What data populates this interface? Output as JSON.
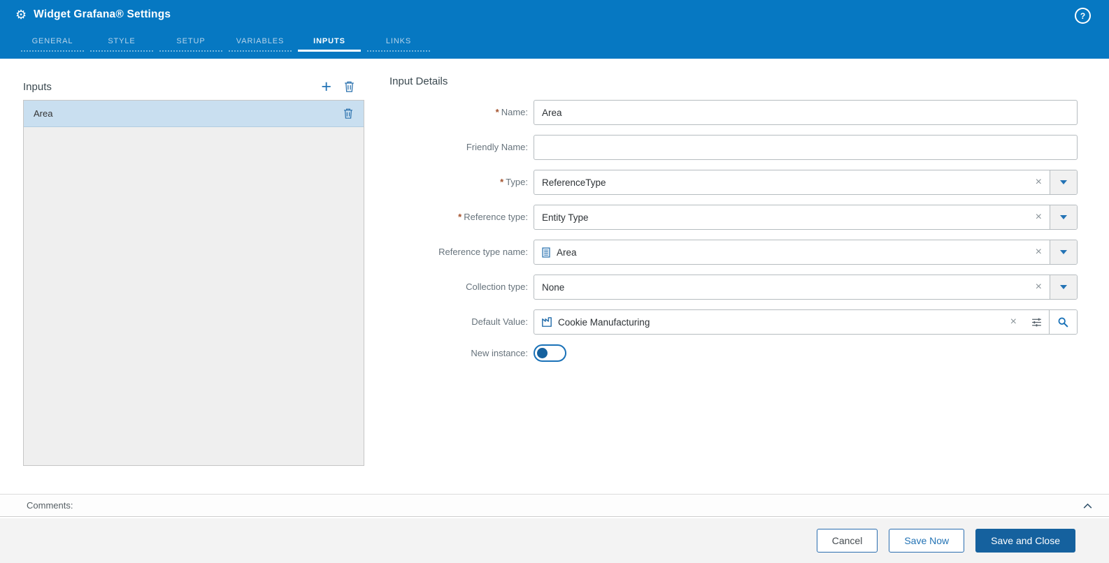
{
  "ui": {
    "required_marker": "*",
    "clear_glyph": "×",
    "add_glyph": "+",
    "help_glyph": "?",
    "gear_glyph": "⚙"
  },
  "header": {
    "title": "Widget Grafana® Settings",
    "tabs": [
      {
        "label": "GENERAL",
        "active": false
      },
      {
        "label": "STYLE",
        "active": false
      },
      {
        "label": "SETUP",
        "active": false
      },
      {
        "label": "VARIABLES",
        "active": false
      },
      {
        "label": "INPUTS",
        "active": true
      },
      {
        "label": "LINKS",
        "active": false
      }
    ]
  },
  "inputs_panel": {
    "title": "Inputs",
    "items": [
      {
        "name": "Area",
        "selected": true
      }
    ]
  },
  "details": {
    "title": "Input Details",
    "name": {
      "label": "Name:",
      "required": true,
      "value": "Area"
    },
    "friendly_name": {
      "label": "Friendly Name:",
      "required": false,
      "value": ""
    },
    "type": {
      "label": "Type:",
      "required": true,
      "value": "ReferenceType"
    },
    "reference_type": {
      "label": "Reference type:",
      "required": true,
      "value": "Entity Type"
    },
    "reference_type_name": {
      "label": "Reference type name:",
      "required": false,
      "value": "Area",
      "icon": "entity-document-icon"
    },
    "collection_type": {
      "label": "Collection type:",
      "required": false,
      "value": "None"
    },
    "default_value": {
      "label": "Default Value:",
      "required": false,
      "value": "Cookie Manufacturing",
      "icon": "factory-icon"
    },
    "new_instance": {
      "label": "New instance:",
      "required": false,
      "value": false
    }
  },
  "comments": {
    "label": "Comments:"
  },
  "footer": {
    "cancel_label": "Cancel",
    "save_now_label": "Save Now",
    "save_and_close_label": "Save and Close"
  },
  "colors": {
    "header_blue": "#0678c2",
    "accent_blue": "#2373b5",
    "primary_button_blue": "#15619e",
    "selected_row_blue": "#c9dff0",
    "required_marker_color": "#a3512c"
  }
}
